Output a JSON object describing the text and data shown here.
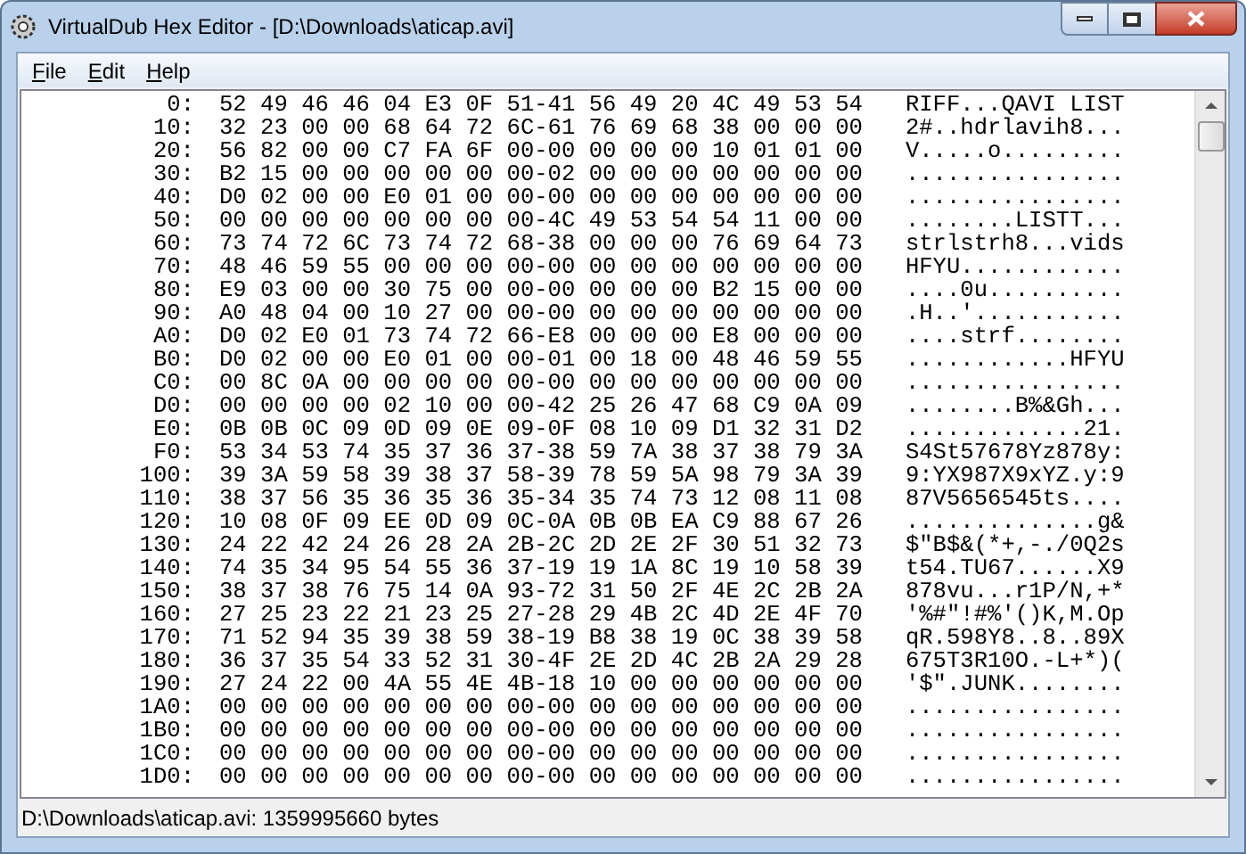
{
  "window": {
    "title": "VirtualDub Hex Editor - [D:\\Downloads\\aticap.avi]"
  },
  "menu": [
    {
      "label": "File"
    },
    {
      "label": "Edit"
    },
    {
      "label": "Help"
    }
  ],
  "rows": [
    {
      "offset": "0:",
      "hex": "52 49 46 46 04 E3 0F 51-41 56 49 20 4C 49 53 54",
      "ascii": "RIFF...QAVI LIST"
    },
    {
      "offset": "10:",
      "hex": "32 23 00 00 68 64 72 6C-61 76 69 68 38 00 00 00",
      "ascii": "2#..hdrlavih8..."
    },
    {
      "offset": "20:",
      "hex": "56 82 00 00 C7 FA 6F 00-00 00 00 00 10 01 01 00",
      "ascii": "V.....o........."
    },
    {
      "offset": "30:",
      "hex": "B2 15 00 00 00 00 00 00-02 00 00 00 00 00 00 00",
      "ascii": "................"
    },
    {
      "offset": "40:",
      "hex": "D0 02 00 00 E0 01 00 00-00 00 00 00 00 00 00 00",
      "ascii": "................"
    },
    {
      "offset": "50:",
      "hex": "00 00 00 00 00 00 00 00-4C 49 53 54 54 11 00 00",
      "ascii": "........LISTT..."
    },
    {
      "offset": "60:",
      "hex": "73 74 72 6C 73 74 72 68-38 00 00 00 76 69 64 73",
      "ascii": "strlstrh8...vids"
    },
    {
      "offset": "70:",
      "hex": "48 46 59 55 00 00 00 00-00 00 00 00 00 00 00 00",
      "ascii": "HFYU............"
    },
    {
      "offset": "80:",
      "hex": "E9 03 00 00 30 75 00 00-00 00 00 00 B2 15 00 00",
      "ascii": "....0u.........."
    },
    {
      "offset": "90:",
      "hex": "A0 48 04 00 10 27 00 00-00 00 00 00 00 00 00 00",
      "ascii": ".H..'..........."
    },
    {
      "offset": "A0:",
      "hex": "D0 02 E0 01 73 74 72 66-E8 00 00 00 E8 00 00 00",
      "ascii": "....strf........"
    },
    {
      "offset": "B0:",
      "hex": "D0 02 00 00 E0 01 00 00-01 00 18 00 48 46 59 55",
      "ascii": "............HFYU"
    },
    {
      "offset": "C0:",
      "hex": "00 8C 0A 00 00 00 00 00-00 00 00 00 00 00 00 00",
      "ascii": "................"
    },
    {
      "offset": "D0:",
      "hex": "00 00 00 00 02 10 00 00-42 25 26 47 68 C9 0A 09",
      "ascii": "........B%&Gh..."
    },
    {
      "offset": "E0:",
      "hex": "0B 0B 0C 09 0D 09 0E 09-0F 08 10 09 D1 32 31 D2",
      "ascii": ".............21."
    },
    {
      "offset": "F0:",
      "hex": "53 34 53 74 35 37 36 37-38 59 7A 38 37 38 79 3A",
      "ascii": "S4St57678Yz878y:"
    },
    {
      "offset": "100:",
      "hex": "39 3A 59 58 39 38 37 58-39 78 59 5A 98 79 3A 39",
      "ascii": "9:YX987X9xYZ.y:9"
    },
    {
      "offset": "110:",
      "hex": "38 37 56 35 36 35 36 35-34 35 74 73 12 08 11 08",
      "ascii": "87V5656545ts...."
    },
    {
      "offset": "120:",
      "hex": "10 08 0F 09 EE 0D 09 0C-0A 0B 0B EA C9 88 67 26",
      "ascii": "..............g&"
    },
    {
      "offset": "130:",
      "hex": "24 22 42 24 26 28 2A 2B-2C 2D 2E 2F 30 51 32 73",
      "ascii": "$\"B$&(*+,-./0Q2s"
    },
    {
      "offset": "140:",
      "hex": "74 35 34 95 54 55 36 37-19 19 1A 8C 19 10 58 39",
      "ascii": "t54.TU67......X9"
    },
    {
      "offset": "150:",
      "hex": "38 37 38 76 75 14 0A 93-72 31 50 2F 4E 2C 2B 2A",
      "ascii": "878vu...r1P/N,+*"
    },
    {
      "offset": "160:",
      "hex": "27 25 23 22 21 23 25 27-28 29 4B 2C 4D 2E 4F 70",
      "ascii": "'%#\"!#%'()K,M.Op"
    },
    {
      "offset": "170:",
      "hex": "71 52 94 35 39 38 59 38-19 B8 38 19 0C 38 39 58",
      "ascii": "qR.598Y8..8..89X"
    },
    {
      "offset": "180:",
      "hex": "36 37 35 54 33 52 31 30-4F 2E 2D 4C 2B 2A 29 28",
      "ascii": "675T3R10O.-L+*)("
    },
    {
      "offset": "190:",
      "hex": "27 24 22 00 4A 55 4E 4B-18 10 00 00 00 00 00 00",
      "ascii": "'$\".JUNK........"
    },
    {
      "offset": "1A0:",
      "hex": "00 00 00 00 00 00 00 00-00 00 00 00 00 00 00 00",
      "ascii": "................"
    },
    {
      "offset": "1B0:",
      "hex": "00 00 00 00 00 00 00 00-00 00 00 00 00 00 00 00",
      "ascii": "................"
    },
    {
      "offset": "1C0:",
      "hex": "00 00 00 00 00 00 00 00-00 00 00 00 00 00 00 00",
      "ascii": "................"
    },
    {
      "offset": "1D0:",
      "hex": "00 00 00 00 00 00 00 00-00 00 00 00 00 00 00 00",
      "ascii": "................"
    }
  ],
  "status_bar": "D:\\Downloads\\aticap.avi: 1359995660 bytes"
}
